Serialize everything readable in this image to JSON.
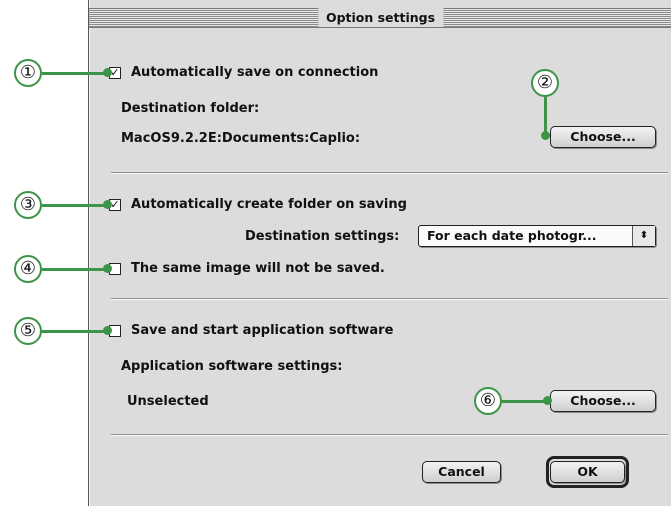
{
  "window": {
    "title": "Option settings"
  },
  "section_save": {
    "auto_save_label": "Automatically save on connection",
    "auto_save_checked": true,
    "dest_folder_label": "Destination folder:",
    "dest_folder_path": "MacOS9.2.2E:Documents:Caplio:",
    "choose_label": "Choose..."
  },
  "section_folder": {
    "auto_create_label": "Automatically create folder on saving",
    "auto_create_checked": true,
    "dest_settings_label": "Destination settings:",
    "dest_settings_value": "For each date photogr...",
    "dest_settings_arrow": "⬍",
    "same_image_label": "The same image will not be saved.",
    "same_image_checked": false
  },
  "section_app": {
    "save_start_label": "Save and start application software",
    "save_start_checked": false,
    "app_settings_label": "Application software settings:",
    "app_value": "Unselected",
    "choose_label": "Choose..."
  },
  "footer": {
    "cancel_label": "Cancel",
    "ok_label": "OK"
  },
  "callouts": {
    "c1": "①",
    "c2": "②",
    "c3": "③",
    "c4": "④",
    "c5": "⑤",
    "c6": "⑥",
    "color": "#3d9448"
  },
  "checkmark_glyph": "✓"
}
